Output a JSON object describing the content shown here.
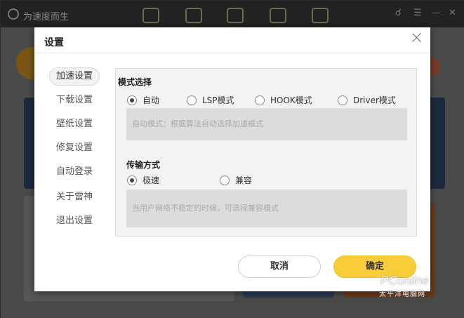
{
  "app": {
    "title": "为速度而生"
  },
  "dialog": {
    "title": "设置"
  },
  "sidebar": {
    "items": [
      {
        "label": "加速设置"
      },
      {
        "label": "下载设置"
      },
      {
        "label": "壁纸设置"
      },
      {
        "label": "修复设置"
      },
      {
        "label": "自动登录"
      },
      {
        "label": "关于雷神"
      },
      {
        "label": "退出设置"
      }
    ],
    "active_index": 0
  },
  "mode_section": {
    "title": "模式选择",
    "options": [
      {
        "label": "自动",
        "checked": true
      },
      {
        "label": "LSP模式",
        "checked": false
      },
      {
        "label": "HOOK模式",
        "checked": false
      },
      {
        "label": "Driver模式",
        "checked": false
      }
    ],
    "hint": "自动模式：根据算法自动选择加速模式"
  },
  "transfer_section": {
    "title": "传输方式",
    "options": [
      {
        "label": "极速",
        "checked": true
      },
      {
        "label": "兼容",
        "checked": false
      }
    ],
    "hint": "当用户网络不稳定的时候，可选择兼容模式"
  },
  "buttons": {
    "cancel_label": "取消",
    "ok_label": "确定"
  },
  "watermark": {
    "brand": "PConline",
    "sub": "太平洋电脑网"
  },
  "colors": {
    "accent": "#f7cd3a",
    "overlay": "#4a4a4a"
  }
}
